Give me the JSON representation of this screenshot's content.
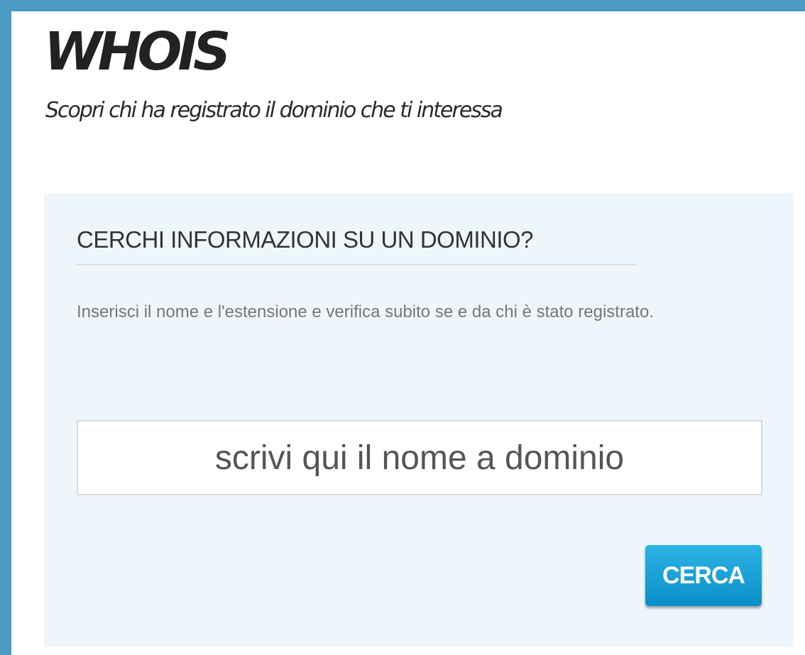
{
  "header": {
    "title": "WHOIS",
    "subtitle": "Scopri chi ha registrato il dominio che ti interessa"
  },
  "search_panel": {
    "heading": "CERCHI INFORMAZIONI SU UN DOMINIO?",
    "description": "Inserisci il nome e l'estensione e verifica subito se e da chi è stato registrato.",
    "input": {
      "value": "",
      "placeholder": "scrivi qui il nome a dominio"
    },
    "button_label": "CERCA"
  },
  "colors": {
    "frame": "#4b9ac4",
    "panel_background": "#eef6fc",
    "button": "#1aa0d8"
  }
}
